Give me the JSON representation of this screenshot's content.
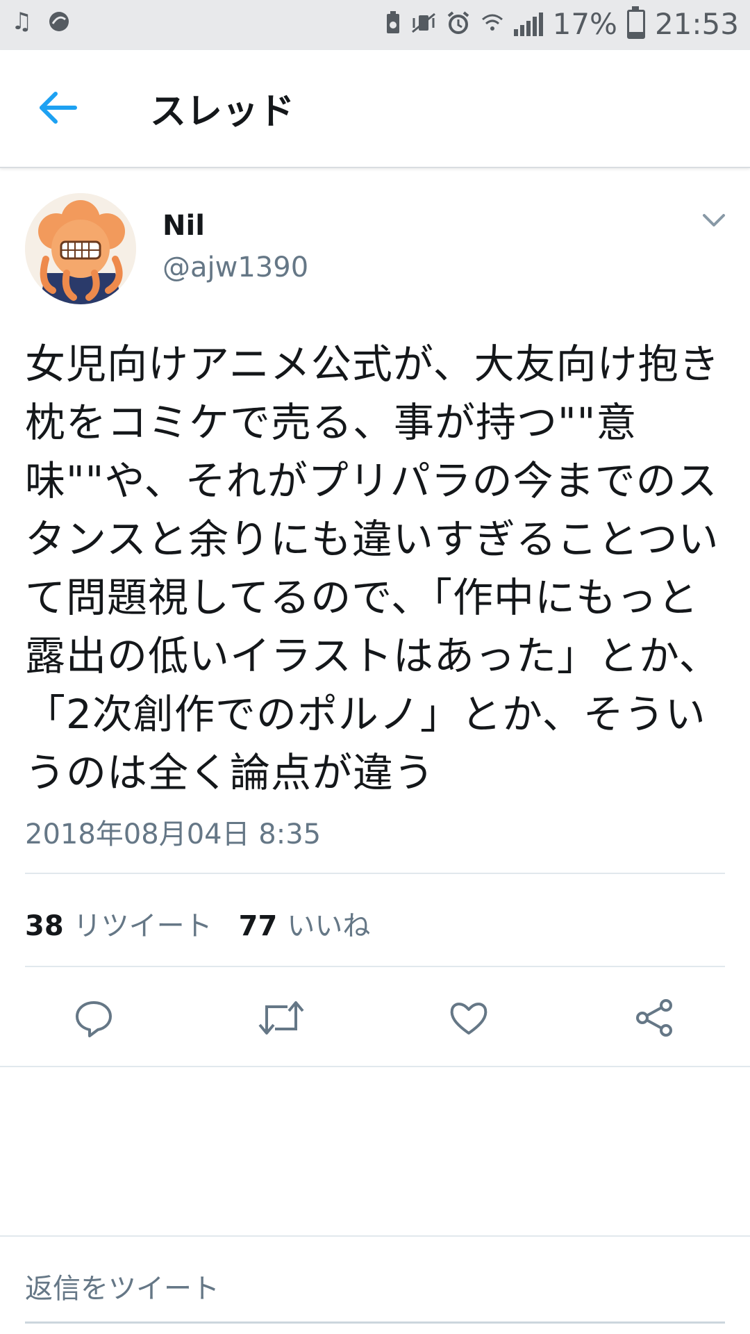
{
  "status_bar": {
    "left_icons": [
      "music-pass-icon",
      "sync-icon"
    ],
    "right_icons": [
      "battery-saver-icon",
      "mute-vibrate-icon",
      "alarm-icon",
      "wifi-icon",
      "signal-icon"
    ],
    "battery_text": "17%",
    "battery_level": 0.17,
    "time": "21:53"
  },
  "header": {
    "title": "スレッド",
    "back_icon": "back-arrow-icon",
    "accent_color": "#1da1f2"
  },
  "tweet": {
    "author_name": "Nil",
    "author_handle": "@ajw1390",
    "text": "女児向けアニメ公式が、大友向け抱き枕をコミケで売る、事が持つ\"\"意味\"\"や、それがプリパラの今までのスタンスと余りにも違いすぎることついて問題視してるので、「作中にもっと露出の低いイラストはあった」とか、「2次創作でのポルノ」とか、そういうのは全く論点が違う",
    "timestamp": "2018年08月04日 8:35",
    "retweet_count": "38",
    "retweet_label": "リツイート",
    "like_count": "77",
    "like_label": "いいね"
  },
  "actions": [
    "reply-icon",
    "retweet-icon",
    "like-icon",
    "share-icon"
  ],
  "reply_input": {
    "placeholder": "返信をツイート"
  }
}
